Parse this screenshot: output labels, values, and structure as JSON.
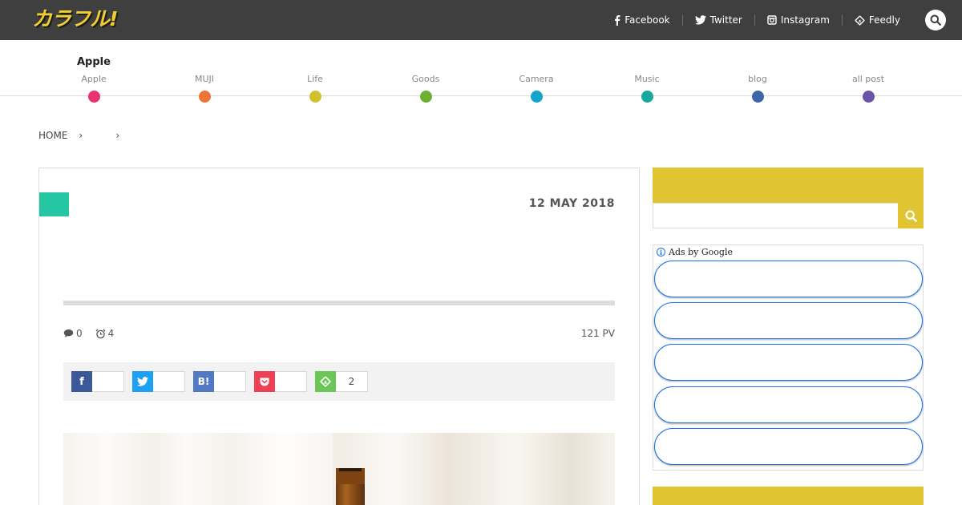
{
  "header": {
    "logo_text": "カラフル!",
    "social": [
      {
        "label": "Facebook",
        "icon": "facebook-icon"
      },
      {
        "label": "Twitter",
        "icon": "twitter-icon"
      },
      {
        "label": "Instagram",
        "icon": "instagram-icon"
      },
      {
        "label": "Feedly",
        "icon": "feedly-icon"
      }
    ],
    "search_icon": "search-icon"
  },
  "nav": {
    "current": "Apple",
    "categories": [
      {
        "label": "Apple",
        "color": "#e8336e"
      },
      {
        "label": "MUJI",
        "color": "#ed7536"
      },
      {
        "label": "Life",
        "color": "#cfc02d"
      },
      {
        "label": "Goods",
        "color": "#6bb033"
      },
      {
        "label": "Camera",
        "color": "#12a6cc"
      },
      {
        "label": "Music",
        "color": "#16a89a"
      },
      {
        "label": "blog",
        "color": "#3d66a6"
      },
      {
        "label": "all post",
        "color": "#6d53a8"
      }
    ]
  },
  "breadcrumb": {
    "home": "HOME",
    "separator": "›"
  },
  "article": {
    "category_color": "#25c6a2",
    "date": "12 MAY 2018",
    "comments": "0",
    "read_time": "4",
    "pv": "121 PV",
    "shares": [
      {
        "service": "facebook",
        "icon_text": "f",
        "color": "#3b5998",
        "count": ""
      },
      {
        "service": "twitter",
        "icon_text": "",
        "color": "#1da1f2",
        "count": ""
      },
      {
        "service": "hatena",
        "icon_text": "B!",
        "color": "#5279c4",
        "count": ""
      },
      {
        "service": "pocket",
        "icon_text": "",
        "color": "#ef4056",
        "count": ""
      },
      {
        "service": "feedly",
        "icon_text": "",
        "color": "#6cc655",
        "count": "2"
      }
    ]
  },
  "sidebar": {
    "accent": "#e0c431",
    "search_placeholder": "",
    "ads_label": "Ads by Google",
    "ad_count": 5
  }
}
